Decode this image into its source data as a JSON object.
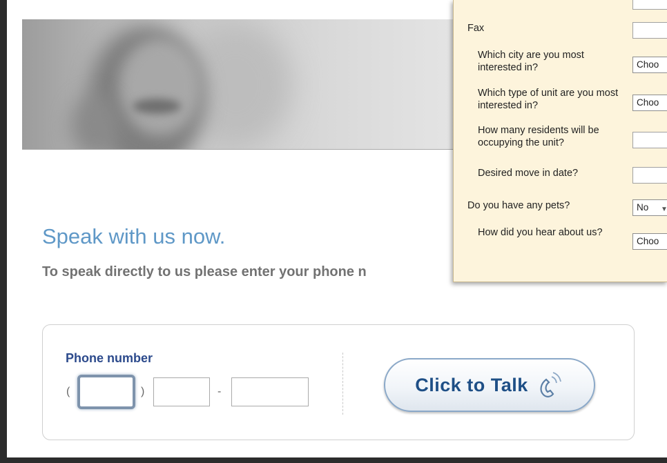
{
  "speak": {
    "headline": "Speak with us now.",
    "subline": "To speak directly to us please enter your phone n"
  },
  "phone": {
    "label": "Phone number",
    "paren_open": "(",
    "paren_close": ")",
    "dash": "-",
    "area_value": "",
    "prefix_value": "",
    "line_value": ""
  },
  "talk_button": {
    "label": "Click to Talk"
  },
  "form": {
    "fields": [
      {
        "label": "Fax",
        "value": ""
      },
      {
        "label": "Which city are you most interested in?",
        "value": "Choo"
      },
      {
        "label": "Which type of unit are you most interested in?",
        "value": "Choo"
      },
      {
        "label": "How many residents will be occupying the unit?",
        "value": ""
      },
      {
        "label": "Desired move in date?",
        "value": ""
      },
      {
        "label": "Do you have any pets?",
        "value": "No"
      },
      {
        "label": "How did you hear about us?",
        "value": "Choo"
      }
    ]
  },
  "colors": {
    "headline": "#5f98c7",
    "phone_label": "#2c4a8c",
    "button_text": "#1e4f86",
    "panel_bg": "#fdf4dc"
  }
}
